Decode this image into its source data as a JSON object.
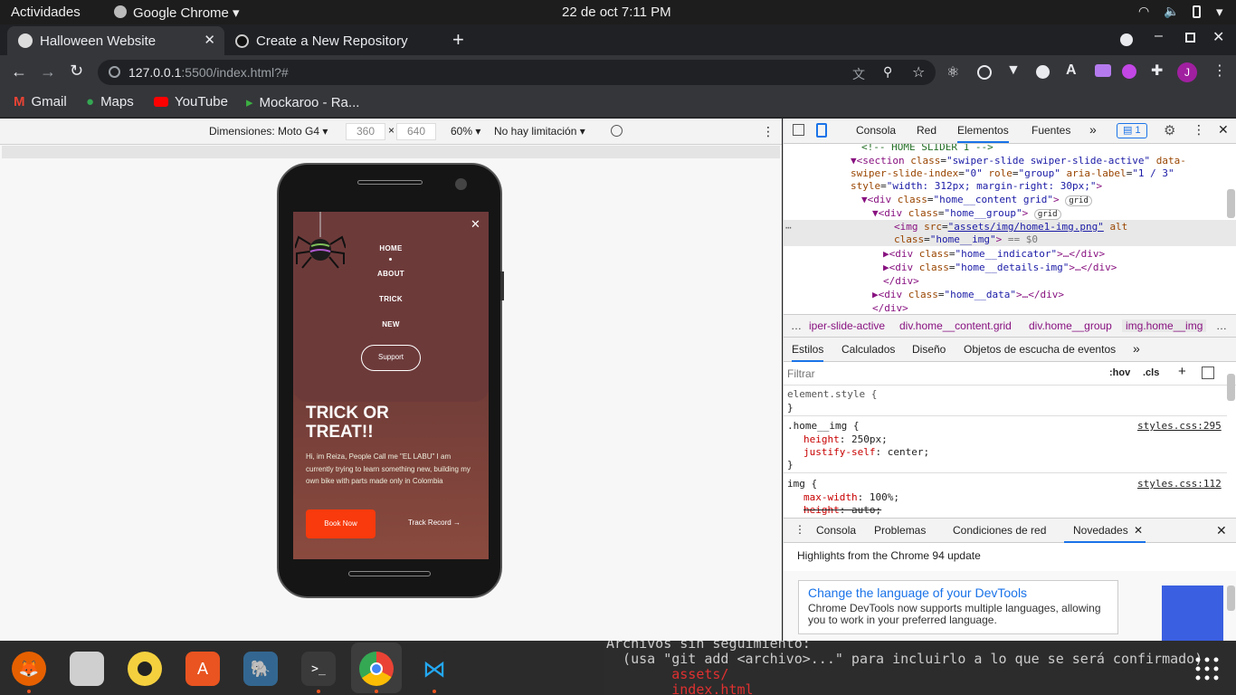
{
  "system_bar": {
    "activities": "Actividades",
    "app": "Google Chrome",
    "datetime": "22 de oct   7:11 PM"
  },
  "tabs": [
    {
      "label": "Halloween Website",
      "active": true
    },
    {
      "label": "Create a New Repository",
      "active": false
    }
  ],
  "address": {
    "host": "127.0.0.1",
    "path": ":5500/index.html?#"
  },
  "avatar_letter": "J",
  "bookmarks": [
    {
      "label": "Gmail",
      "icon": "gmail-icon"
    },
    {
      "label": "Maps",
      "icon": "maps-icon"
    },
    {
      "label": "YouTube",
      "icon": "youtube-icon"
    },
    {
      "label": "Mockaroo - Ra...",
      "icon": "mockaroo-icon"
    }
  ],
  "device_toolbar": {
    "dimensions_label": "Dimensiones: Moto G4",
    "width": "360",
    "height": "640",
    "zoom": "60%",
    "throttle": "No hay limitación"
  },
  "site": {
    "nav": [
      "HOME",
      "ABOUT",
      "TRICK",
      "NEW"
    ],
    "support_button": "Support",
    "title": "TRICK OR TREAT!!",
    "description": "Hi, im Reiza, People Call me \"EL LABU\" I am currently trying to learn something new, building my own bike with parts made only in Colombia",
    "book_button": "Book Now",
    "track_link": "Track Record"
  },
  "devtools": {
    "tabs": [
      "Consola",
      "Red",
      "Elementos",
      "Fuentes"
    ],
    "active_tab": "Elementos",
    "issues_count": "1",
    "dom_lines": [
      {
        "text": "<!-- HOME SLIDER 1 -->"
      },
      {
        "text": "▼<section class=\"swiper-slide swiper-slide-active\" data-swiper-slide-index=\"0\" role=\"group\" aria-label=\"1 / 3\" style=\"width: 312px; margin-right: 30px;\">"
      },
      {
        "text": "▼<div class=\"home__content grid\">",
        "badge": "grid"
      },
      {
        "text": "▼<div class=\"home__group\">",
        "badge": "grid"
      },
      {
        "text": "<img src=\"assets/img/home1-img.png\" alt class=\"home__img\"> == $0"
      },
      {
        "text": "▶<div class=\"home__indicator\">…</div>"
      },
      {
        "text": "▶<div class=\"home__details-img\">…</div>"
      },
      {
        "text": "</div>"
      },
      {
        "text": "▶<div class=\"home__data\">…</div>"
      },
      {
        "text": "</div>"
      }
    ],
    "breadcrumbs": [
      "…",
      "iper-slide-active",
      "div.home__content.grid",
      "div.home__group",
      "img.home__img",
      "…"
    ],
    "style_tabs": [
      "Estilos",
      "Calculados",
      "Diseño",
      "Objetos de escucha de eventos"
    ],
    "filter_placeholder": "Filtrar",
    "hov": ":hov",
    "cls": ".cls",
    "rules": [
      {
        "selector": "element.style {",
        "source": "",
        "props": []
      },
      {
        "selector": ".home__img {",
        "source": "styles.css:295",
        "props": [
          {
            "name": "height",
            "value": "250px;"
          },
          {
            "name": "justify-self",
            "value": "center;"
          }
        ]
      },
      {
        "selector": "img {",
        "source": "styles.css:112",
        "props": [
          {
            "name": "max-width",
            "value": "100%;"
          },
          {
            "name": "height",
            "value": "auto;",
            "struck": true
          }
        ]
      }
    ],
    "drawer_tabs": [
      "Consola",
      "Problemas",
      "Condiciones de red",
      "Novedades"
    ],
    "drawer_active": "Novedades",
    "highlights": "Highlights from the Chrome 94 update",
    "news_title": "Change the language of your DevTools",
    "news_body": "Chrome DevTools now supports multiple languages, allowing you to work in your preferred language."
  },
  "terminal_lines": [
    "Archivos sin seguimiento:",
    "  (usa \"git add <archivo>...\" para incluirlo a lo que se será confirmado)",
    "        assets/",
    "        index.html"
  ],
  "colors": {
    "accent_orange": "#f83a0c",
    "devtools_blue": "#1a73e8",
    "chrome_dark": "#35363a"
  }
}
